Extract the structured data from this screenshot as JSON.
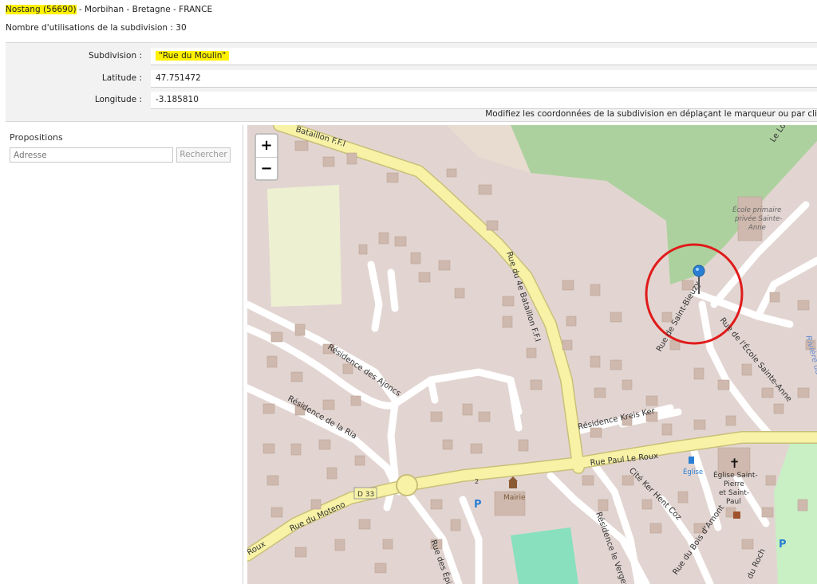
{
  "header": {
    "commune": "Nostang (56690)",
    "region": " - Morbihan - Bretagne - FRANCE",
    "usage_label": "Nombre d'utilisations de la subdivision : ",
    "usage_count": "30"
  },
  "form": {
    "subdivision_label": "Subdivision :",
    "subdivision_value": "\"Rue du Moulin\"",
    "latitude_label": "Latitude :",
    "latitude_value": "47.751472",
    "longitude_label": "Longitude :",
    "longitude_value": "-3.185810",
    "hint": "Modifiez les coordonnées de la subdivision en déplaçant le marqueur ou par cli"
  },
  "propositions": {
    "title": "Propositions",
    "address_placeholder": "Adresse",
    "search_label": "Rechercher"
  },
  "map": {
    "zoom_in": "+",
    "zoom_out": "−",
    "labels": {
      "bataillon_top": "Bataillon F.F.I",
      "rue_4e_bataillon": "Rue du 4e Bataillon F.F.I",
      "residence_ajoncs": "Résidence des Ajoncs",
      "residence_ria": "Résidence de la Ria",
      "rue_moteno": "Rue du Moteno",
      "d33": "D 33",
      "roux": "Roux",
      "rue_paul_le_roux": "Rue Paul Le Roux",
      "residence_kreis_ker": "Résidence Kreis Ker",
      "cite_ker_hent_coz": "Cité Ker Hent Coz",
      "residence_le_verger": "Résidence le Verger",
      "rue_des_epi": "Rue des Épi",
      "rue_saint_bieuzy": "Rue de Saint-Bieuzy",
      "rue_ecole_sainte_anne": "Rue de l'École Sainte-Anne",
      "ecole_1": "École primaire",
      "ecole_2": "privée Sainte-",
      "ecole_3": "Anne",
      "eglise_1": "Église Saint-",
      "eglise_2": "Pierre",
      "eglise_3": "et Saint-",
      "eglise_4": "Paul",
      "eglise_bus": "Église",
      "mairie": "Mairie",
      "rue_bois_amont": "Rue du Bois d'Amont",
      "du_roch": "du Roch",
      "le_lo": "Le Lo",
      "riviere": "Rivière du",
      "parking": "P",
      "two": "2"
    },
    "colors": {
      "background": "#e2d5d1",
      "main_road": "#f7f2a6",
      "road_casing": "#c9bf7a",
      "minor_road": "#ffffff",
      "building": "#cfb8ad",
      "forest": "#add19e",
      "field": "#eef0d2",
      "marker": "#2a7fd4",
      "circle": "#e01b1b",
      "sports": "#88e0be"
    }
  }
}
